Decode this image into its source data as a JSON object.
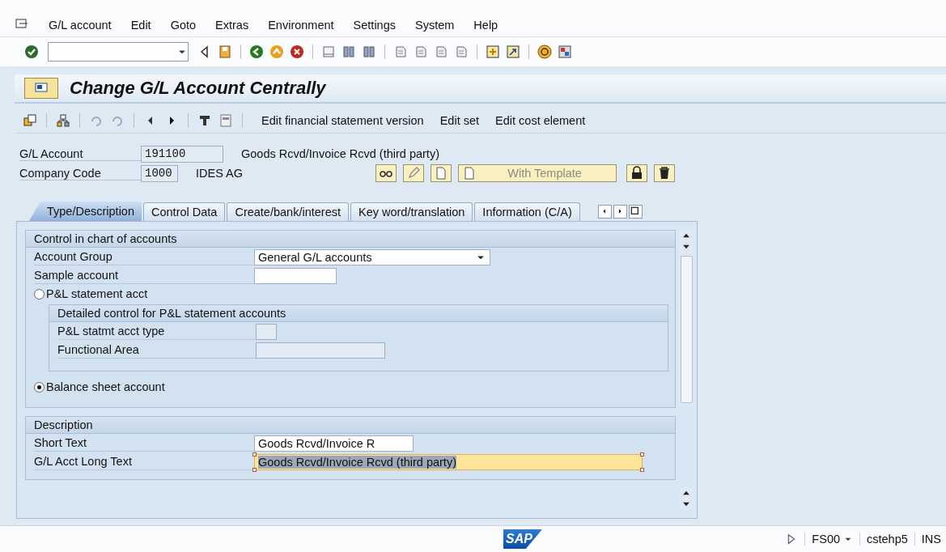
{
  "menu": [
    {
      "label": "G/L account"
    },
    {
      "label": "Edit"
    },
    {
      "label": "Goto"
    },
    {
      "label": "Extras"
    },
    {
      "label": "Environment"
    },
    {
      "label": "Settings"
    },
    {
      "label": "System"
    },
    {
      "label": "Help"
    }
  ],
  "title": "Change G/L Account Centrally",
  "app_toolbar": {
    "buttons": [
      "Edit financial statement version",
      "Edit set",
      "Edit cost element"
    ]
  },
  "header": {
    "fields": [
      {
        "label": "G/L Account",
        "value": "191100",
        "description": "Goods Rcvd/Invoice Rcvd (third party)"
      },
      {
        "label": "Company Code",
        "value": "1000",
        "description": "IDES AG"
      }
    ],
    "template_button": "With Template"
  },
  "tabs": [
    {
      "label": "Type/Description",
      "selected": true
    },
    {
      "label": "Control Data",
      "selected": false
    },
    {
      "label": "Create/bank/interest",
      "selected": false
    },
    {
      "label": "Key word/translation",
      "selected": false
    },
    {
      "label": "Information (C/A)",
      "selected": false
    }
  ],
  "control_group": {
    "title": "Control in chart of accounts",
    "fields": [
      {
        "label": "Account Group",
        "value": "General G/L accounts",
        "kind": "dropdown"
      },
      {
        "label": "Sample account",
        "kind": "text"
      }
    ],
    "options": [
      {
        "label": "P&L statement acct",
        "selected": false
      },
      {
        "label": "Balance sheet account",
        "selected": true
      }
    ],
    "pl_group": {
      "title": "Detailed control for P&L statement accounts",
      "fields": [
        {
          "label": "P&L statmt acct type",
          "kind": "small"
        },
        {
          "label": "Functional Area",
          "kind": "text"
        }
      ]
    }
  },
  "description_group": {
    "title": "Description",
    "fields": [
      {
        "label": "Short Text",
        "value": "Goods Rcvd/Invoice R",
        "focused": false
      },
      {
        "label": "G/L Acct Long Text",
        "value": "Goods Rcvd/Invoice Rcvd (third party)",
        "focused": true
      }
    ]
  },
  "status_bar": {
    "logo": "SAP",
    "transaction": "FS00",
    "system": "cstehp5",
    "mode": "INS"
  }
}
